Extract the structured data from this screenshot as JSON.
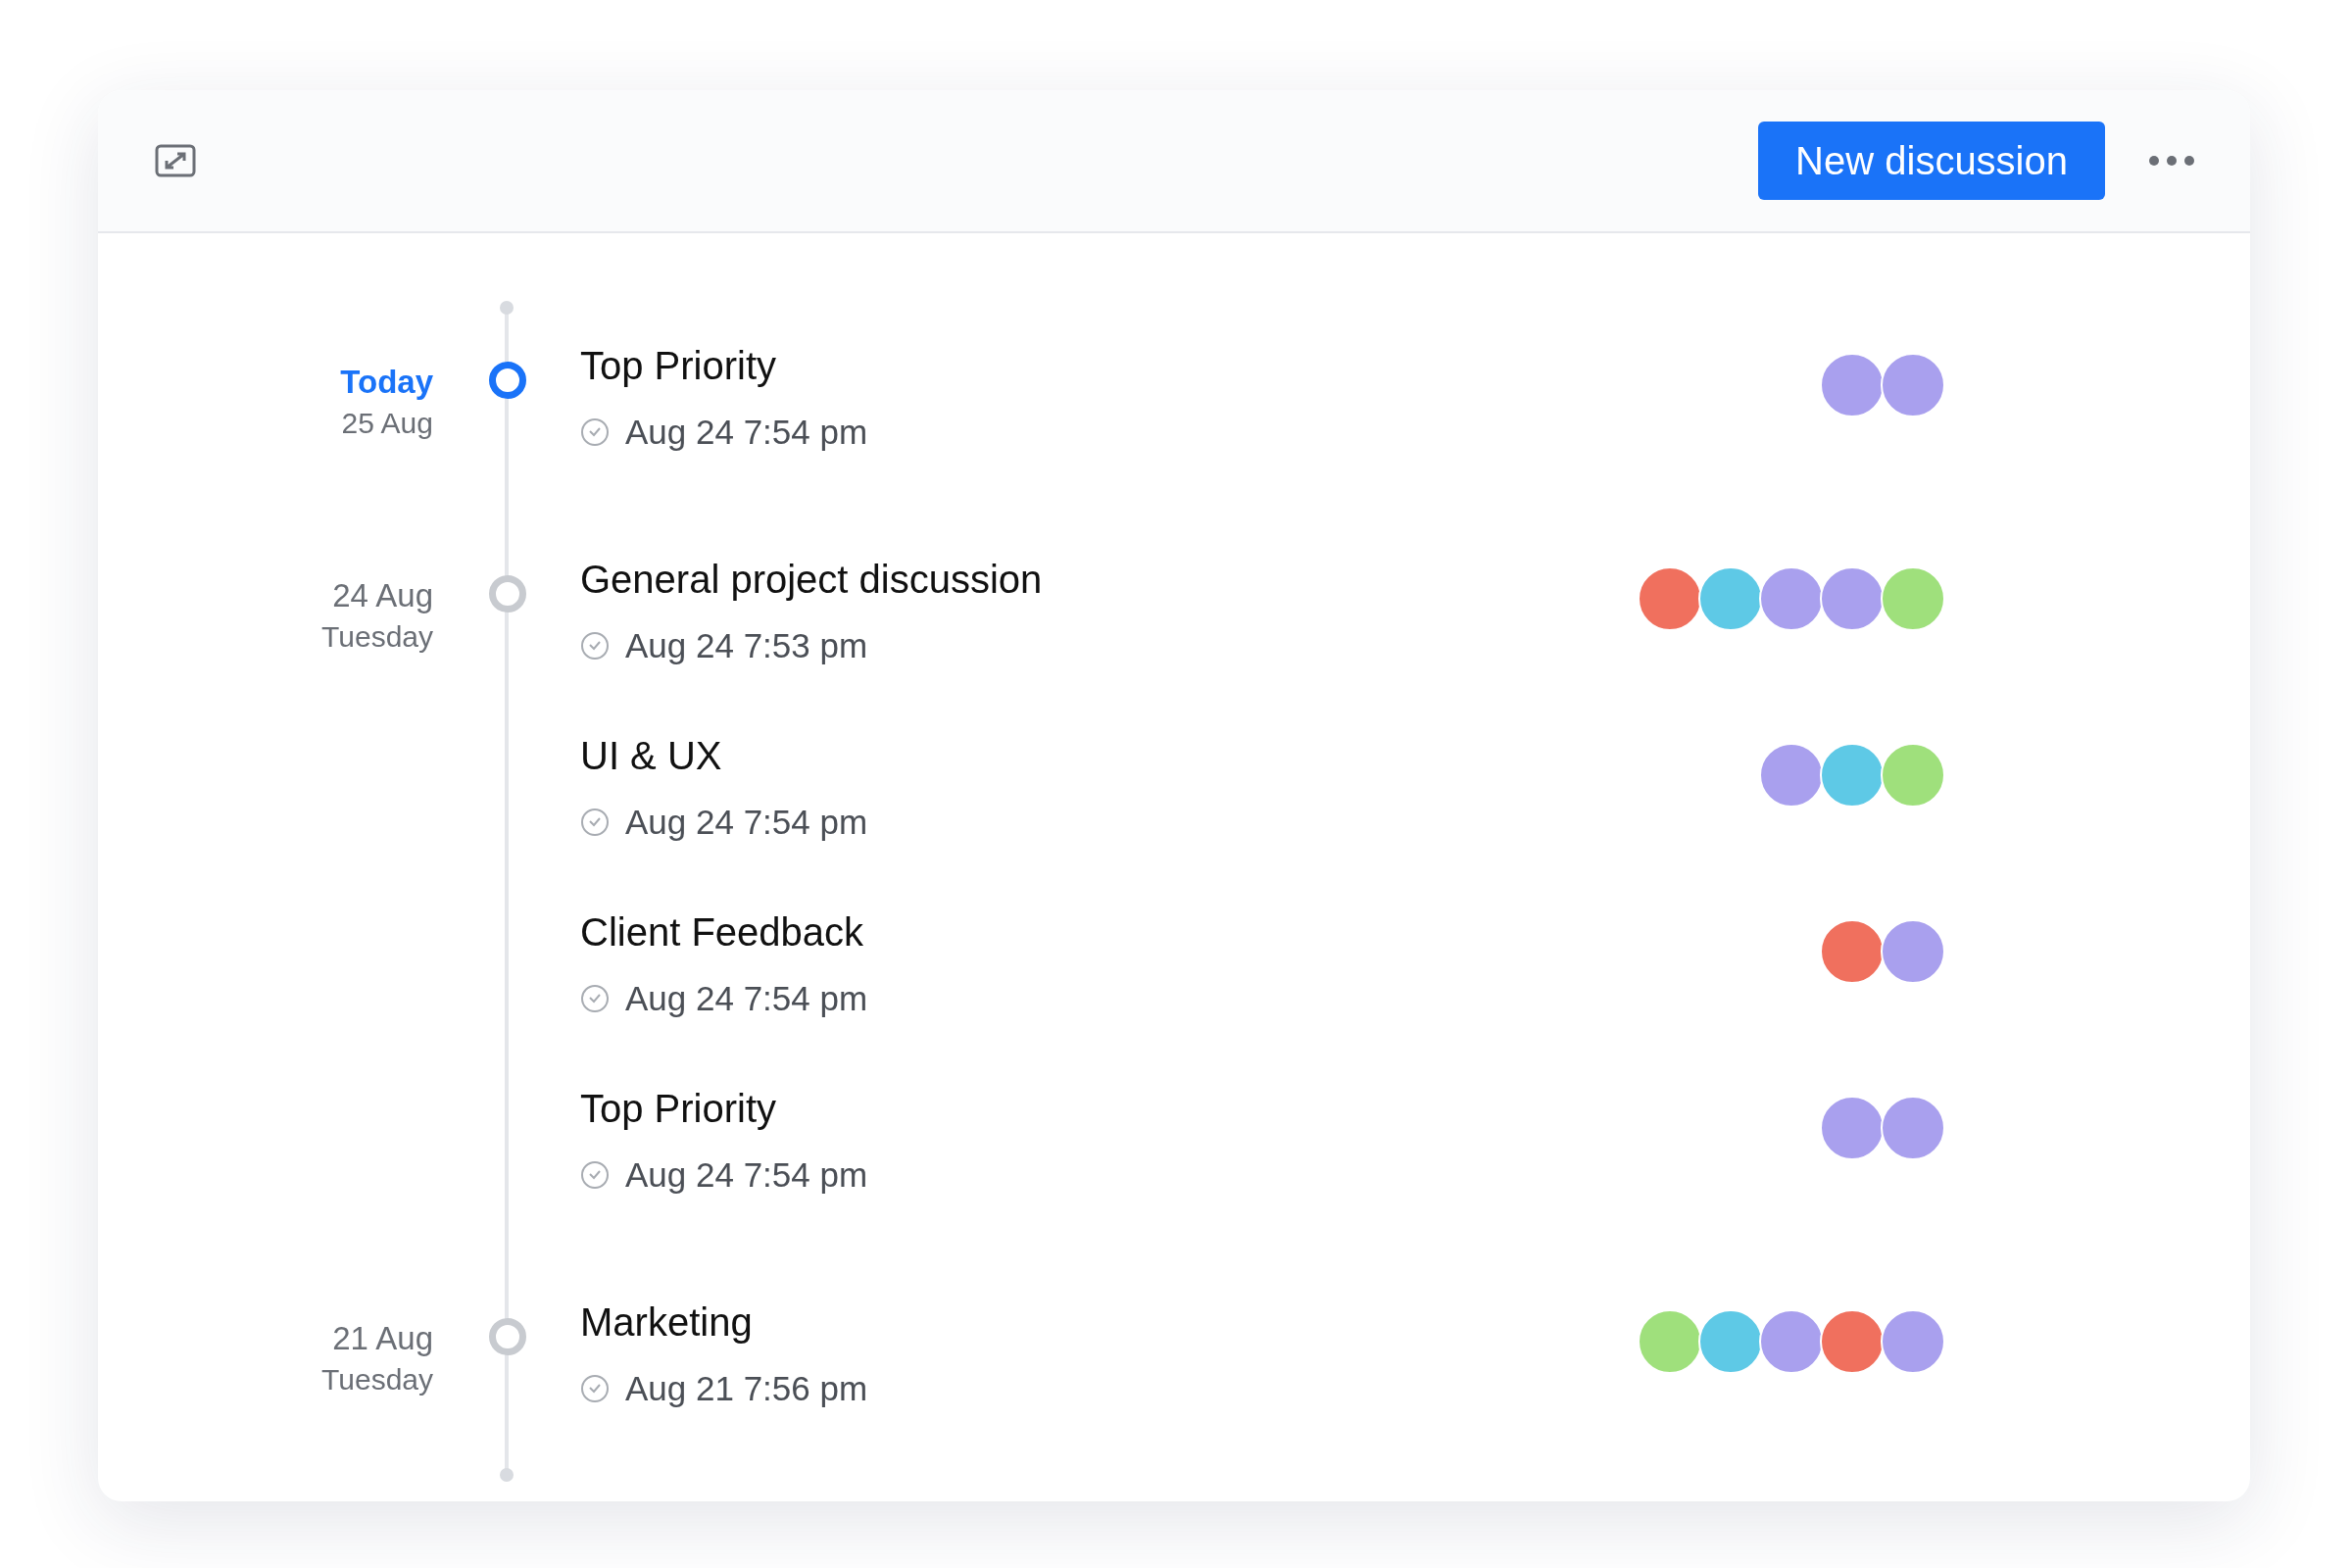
{
  "header": {
    "button": "New discussion"
  },
  "groups": [
    {
      "label": "Today",
      "sublabel": "25 Aug",
      "selected": true,
      "items": [
        {
          "title": "Top Priority",
          "time": "Aug 24 7:54 pm",
          "avatars": [
            {
              "color": "#a9a0ee"
            },
            {
              "color": "#a9a0ee"
            }
          ]
        }
      ]
    },
    {
      "label": "24 Aug",
      "sublabel": "Tuesday",
      "selected": false,
      "items": [
        {
          "title": "General project discussion",
          "time": "Aug 24 7:53 pm",
          "avatars": [
            {
              "color": "#f0705e"
            },
            {
              "color": "#5ec9e6"
            },
            {
              "color": "#a9a0ee"
            },
            {
              "color": "#a9a0ee"
            },
            {
              "color": "#9fe07c"
            }
          ]
        },
        {
          "title": "UI & UX",
          "time": "Aug 24 7:54 pm",
          "avatars": [
            {
              "color": "#a9a0ee"
            },
            {
              "color": "#5ec9e6"
            },
            {
              "color": "#9fe07c"
            }
          ]
        },
        {
          "title": "Client Feedback",
          "time": "Aug 24 7:54 pm",
          "avatars": [
            {
              "color": "#f0705e"
            },
            {
              "color": "#a9a0ee"
            }
          ]
        },
        {
          "title": "Top Priority",
          "time": "Aug 24 7:54 pm",
          "avatars": [
            {
              "color": "#a9a0ee"
            },
            {
              "color": "#a9a0ee"
            }
          ]
        }
      ]
    },
    {
      "label": "21 Aug",
      "sublabel": "Tuesday",
      "selected": false,
      "items": [
        {
          "title": "Marketing",
          "time": "Aug 21 7:56 pm",
          "avatars": [
            {
              "color": "#9fe07c"
            },
            {
              "color": "#5ec9e6"
            },
            {
              "color": "#a9a0ee"
            },
            {
              "color": "#f0705e"
            },
            {
              "color": "#a9a0ee"
            }
          ]
        }
      ]
    }
  ]
}
